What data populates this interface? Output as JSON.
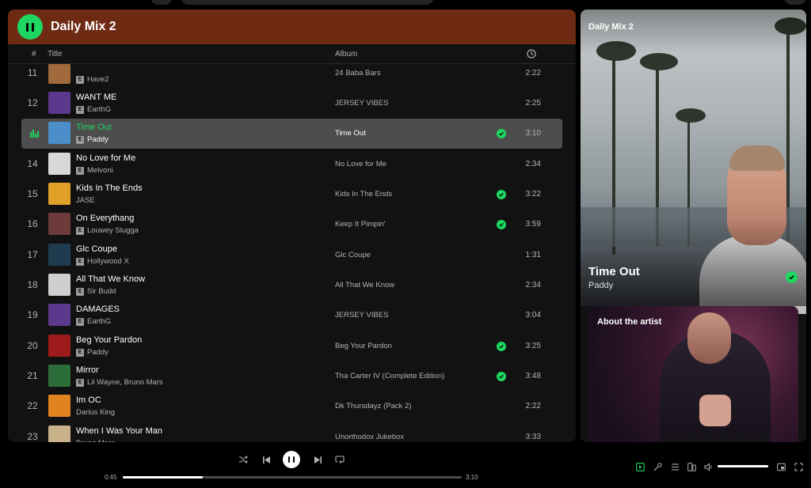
{
  "header": {
    "title": "Daily Mix 2"
  },
  "columns": {
    "number": "#",
    "title": "Title",
    "album": "Album",
    "duration_icon": "clock-icon"
  },
  "tracks": [
    {
      "num": "11",
      "title": "",
      "artist": "Have2",
      "explicit": "E",
      "album": "24 Baba Bars",
      "duration": "2:22",
      "liked": false,
      "thumb": "#a06a3c"
    },
    {
      "num": "12",
      "title": "WANT ME",
      "artist": "EarthG",
      "explicit": "E",
      "album": "JERSEY VIBES",
      "duration": "2:25",
      "liked": false,
      "thumb": "#5b3a8e"
    },
    {
      "num": "13",
      "title": "Time Out",
      "artist": "Paddy",
      "explicit": "E",
      "album": "Time Out",
      "duration": "3:10",
      "liked": true,
      "thumb": "#4b8ec9",
      "active": true
    },
    {
      "num": "14",
      "title": "No Love for Me",
      "artist": "Melvoni",
      "explicit": "E",
      "album": "No Love for Me",
      "duration": "2:34",
      "liked": false,
      "thumb": "#d8d8d8"
    },
    {
      "num": "15",
      "title": "Kids In The Ends",
      "artist": "JASE",
      "explicit": "",
      "album": "Kids In The Ends",
      "duration": "3:22",
      "liked": true,
      "thumb": "#e0a12b"
    },
    {
      "num": "16",
      "title": "On Everythang",
      "artist": "Louwey Slugga",
      "explicit": "E",
      "album": "Keep It Pimpin'",
      "duration": "3:59",
      "liked": true,
      "thumb": "#6e3b3b"
    },
    {
      "num": "17",
      "title": "Glc Coupe",
      "artist": "Hollywood X",
      "explicit": "E",
      "album": "Glc Coupe",
      "duration": "1:31",
      "liked": false,
      "thumb": "#1f3b50"
    },
    {
      "num": "18",
      "title": "All That We Know",
      "artist": "Sir Budd",
      "explicit": "E",
      "album": "All That We Know",
      "duration": "2:34",
      "liked": false,
      "thumb": "#cfcfcf"
    },
    {
      "num": "19",
      "title": "DAMAGES",
      "artist": "EarthG",
      "explicit": "E",
      "album": "JERSEY VIBES",
      "duration": "3:04",
      "liked": false,
      "thumb": "#5b3a8e"
    },
    {
      "num": "20",
      "title": "Beg Your Pardon",
      "artist": "Paddy",
      "explicit": "E",
      "album": "Beg Your Pardon",
      "duration": "3:25",
      "liked": true,
      "thumb": "#9e1b1b"
    },
    {
      "num": "21",
      "title": "Mirror",
      "artist": "Lil Wayne, Bruno Mars",
      "explicit": "E",
      "album": "Tha Carter IV (Complete Edition)",
      "duration": "3:48",
      "liked": true,
      "thumb": "#2d6d3a"
    },
    {
      "num": "22",
      "title": "Im OC",
      "artist": "Darius King",
      "explicit": "",
      "album": "Dk Thursdayz (Pack 2)",
      "duration": "2:22",
      "liked": false,
      "thumb": "#e08420"
    },
    {
      "num": "23",
      "title": "When I Was Your Man",
      "artist": "Bruno Mars",
      "explicit": "",
      "album": "Unorthodox Jukebox",
      "duration": "3:33",
      "liked": false,
      "thumb": "#c9b28a"
    }
  ],
  "sidebar": {
    "playlist_label": "Daily Mix 2",
    "song_title": "Time Out",
    "song_artist": "Paddy",
    "about_title": "About the artist"
  },
  "player": {
    "elapsed": "0:45",
    "total": "3:10",
    "progress": 0.237,
    "volume": 1.0,
    "controls": [
      "shuffle-icon",
      "previous-icon",
      "pause-icon",
      "next-icon",
      "repeat-icon"
    ],
    "right_controls": [
      "now-playing-view-icon",
      "lyrics-icon",
      "queue-icon",
      "connect-device-icon",
      "volume-icon",
      "miniplayer-icon",
      "fullscreen-icon"
    ]
  },
  "colors": {
    "accent": "#1ed760",
    "header_bg": "#6e2a13",
    "panel_bg": "#121212"
  }
}
